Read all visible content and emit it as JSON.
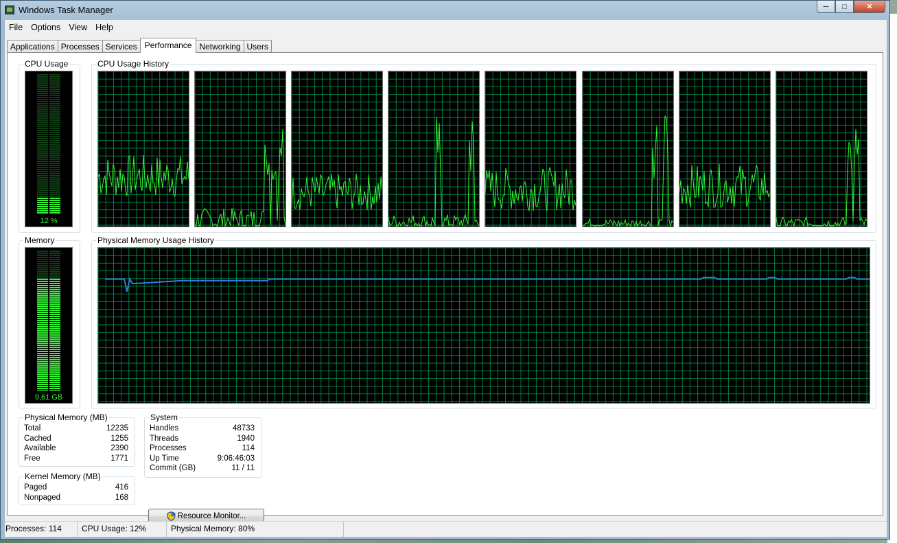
{
  "window": {
    "title": "Windows Task Manager"
  },
  "menu": [
    "File",
    "Options",
    "View",
    "Help"
  ],
  "tabs": [
    {
      "label": "Applications"
    },
    {
      "label": "Processes"
    },
    {
      "label": "Services"
    },
    {
      "label": "Performance",
      "active": true
    },
    {
      "label": "Networking"
    },
    {
      "label": "Users"
    }
  ],
  "cpu_usage": {
    "label": "CPU Usage",
    "value_text": "12 %",
    "level": 0.12
  },
  "cpu_history": {
    "label": "CPU Usage History",
    "core_count": 8
  },
  "memory": {
    "label": "Memory",
    "value_text": "9,61 GB",
    "level": 0.8
  },
  "memory_history": {
    "label": "Physical Memory Usage History"
  },
  "physical_memory": {
    "label": "Physical Memory (MB)",
    "rows": [
      {
        "name": "Total",
        "value": "12235"
      },
      {
        "name": "Cached",
        "value": "1255"
      },
      {
        "name": "Available",
        "value": "2390"
      },
      {
        "name": "Free",
        "value": "1771"
      }
    ]
  },
  "kernel_memory": {
    "label": "Kernel Memory (MB)",
    "rows": [
      {
        "name": "Paged",
        "value": "416"
      },
      {
        "name": "Nonpaged",
        "value": "168"
      }
    ]
  },
  "system": {
    "label": "System",
    "rows": [
      {
        "name": "Handles",
        "value": "48733"
      },
      {
        "name": "Threads",
        "value": "1940"
      },
      {
        "name": "Processes",
        "value": "114"
      },
      {
        "name": "Up Time",
        "value": "9:06:46:03"
      },
      {
        "name": "Commit (GB)",
        "value": "11 / 11"
      }
    ]
  },
  "resource_monitor_button": {
    "label": "Resource Monitor..."
  },
  "statusbar": {
    "processes": "Processes: 114",
    "cpu": "CPU Usage: 12%",
    "memory": "Physical Memory: 80%"
  },
  "colors": {
    "graph_line": "#34f534",
    "graph_grid": "#008040",
    "memory_line": "#2f7fe0"
  },
  "icons": [
    "app-icon",
    "minimize-icon",
    "maximize-icon",
    "close-icon",
    "shield-icon"
  ]
}
